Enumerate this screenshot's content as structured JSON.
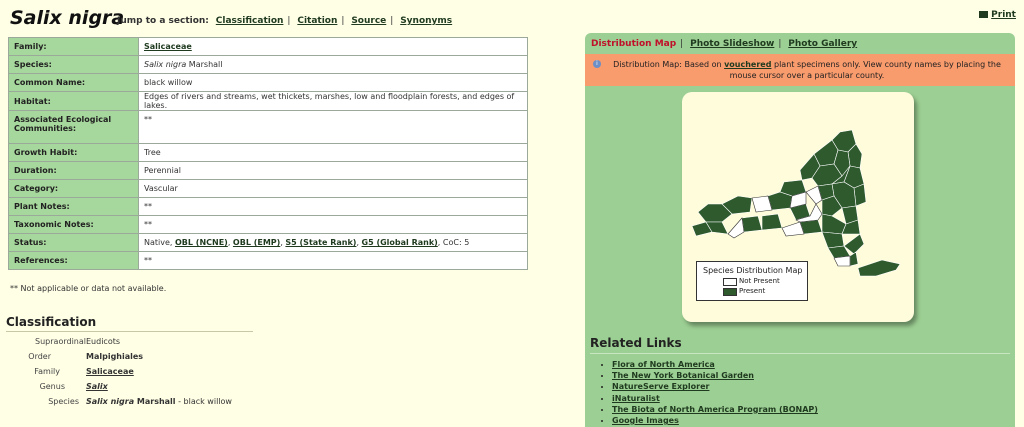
{
  "header": {
    "title": "Salix nigra",
    "jump_label": "Jump to a section:",
    "jump_links": [
      "Classification",
      "Citation",
      "Source",
      "Synonyms"
    ],
    "print_label": "Print"
  },
  "info_rows": [
    {
      "label": "Family:",
      "value": "Salicaceae",
      "link": true
    },
    {
      "label": "Species:",
      "value_italic": "Salix nigra",
      "value": " Marshall"
    },
    {
      "label": "Common Name:",
      "value": "black willow"
    },
    {
      "label": "Habitat:",
      "value": "Edges of rivers and streams, wet thickets, marshes, low and floodplain forests, and edges of lakes."
    },
    {
      "label": "Associated Ecological Communities:",
      "value": "**"
    },
    {
      "label": "Growth Habit:",
      "value": "Tree"
    },
    {
      "label": "Duration:",
      "value": "Perennial"
    },
    {
      "label": "Category:",
      "value": "Vascular"
    },
    {
      "label": "Plant Notes:",
      "value": "**"
    },
    {
      "label": "Taxonomic Notes:",
      "value": "**"
    },
    {
      "label": "Status:",
      "status_prefix": "Native, ",
      "status_links": [
        "OBL (NCNE)",
        "OBL (EMP)",
        "S5 (State Rank)",
        "G5 (Global Rank)"
      ],
      "status_suffix": ", CoC: 5"
    },
    {
      "label": "References:",
      "value": "**"
    }
  ],
  "note": "** Not applicable or data not available.",
  "classification": {
    "heading": "Classification",
    "rows": [
      {
        "rank": "Supraordinal",
        "value": "Eudicots"
      },
      {
        "rank": "Order",
        "value": "Malpighiales"
      },
      {
        "rank": "Family",
        "value": "Salicaceae"
      },
      {
        "rank": "Genus",
        "value": "Salix"
      },
      {
        "rank": "Species",
        "value_italic": "Salix nigra",
        "value": " Marshall",
        "suffix": " - black willow"
      }
    ]
  },
  "panel": {
    "tabs": [
      "Distribution Map",
      "Photo Slideshow",
      "Photo Gallery"
    ],
    "alert_prefix": "Distribution Map: Based on ",
    "alert_link": "vouchered",
    "alert_suffix": " plant specimens only. View county names by placing the mouse cursor over a particular county.",
    "legend_title": "Species Distribution Map",
    "legend_not_present": "Not Present",
    "legend_present": "Present",
    "present_color": "#2e5a2e",
    "absent_color": "#ffffff",
    "related_heading": "Related Links",
    "related_links": [
      "Flora of North America",
      "The New York Botanical Garden",
      "NatureServe Explorer",
      "iNaturalist",
      "The Biota of North America Program (BONAP)",
      "Google Images"
    ]
  }
}
